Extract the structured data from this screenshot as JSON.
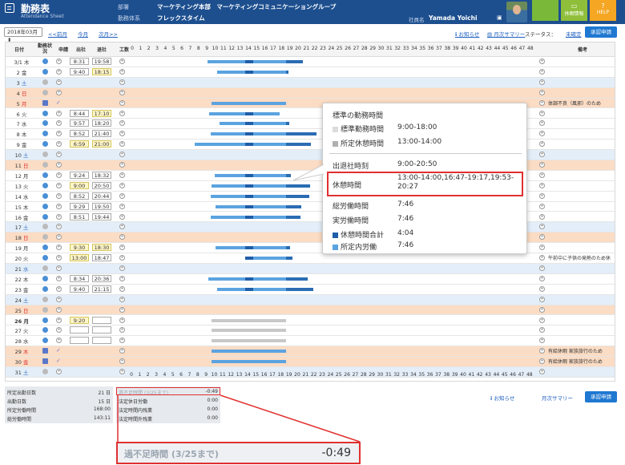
{
  "header": {
    "title": "勤務表",
    "subtitle": "Attendance Sheet",
    "dept_label": "部署",
    "dept": "マーケティング本部　マーケティングコミュニケーショングループ",
    "system_label": "勤務体系",
    "system": "フレックスタイム",
    "user_label": "社員名",
    "user_name": "Yamada Yoichi",
    "btn2": "休暇情報",
    "btn3": "HELP"
  },
  "toolbar": {
    "month": "2018年03月",
    "prev": "<<前月",
    "today": "今月",
    "next": "次月>>",
    "notice": "お知らせ",
    "monthly": "月次サマリー",
    "status_label": "ステータス：",
    "status": "未確定",
    "approve": "承認申請"
  },
  "grid": {
    "headers": [
      "日付",
      "勤務状況",
      "申請",
      "出社",
      "退社",
      "工数"
    ],
    "note_header": "備考",
    "hours": [
      "0",
      "1",
      "2",
      "3",
      "4",
      "5",
      "6",
      "7",
      "8",
      "9",
      "10",
      "11",
      "12",
      "13",
      "14",
      "15",
      "16",
      "17",
      "18",
      "19",
      "20",
      "21",
      "22",
      "23",
      "24",
      "25",
      "26",
      "27",
      "28",
      "29",
      "30",
      "31",
      "32",
      "33",
      "34",
      "35",
      "36",
      "37",
      "38",
      "39",
      "40",
      "41",
      "42",
      "43",
      "44",
      "45",
      "46",
      "47",
      "48"
    ],
    "rows": [
      {
        "d": "3/1",
        "w": "木",
        "in": "8:31",
        "out": "19:58",
        "t": "n"
      },
      {
        "d": "2",
        "w": "金",
        "in": "9:40",
        "out": "18:15",
        "t": "n",
        "y2": 1
      },
      {
        "d": "3",
        "w": "土",
        "t": "s"
      },
      {
        "d": "4",
        "w": "日",
        "t": "h"
      },
      {
        "d": "5",
        "w": "月",
        "t": "h",
        "note": "体調不良（風邪）のため"
      },
      {
        "d": "6",
        "w": "火",
        "in": "8:44",
        "out": "17:10",
        "t": "n",
        "y2": 1
      },
      {
        "d": "7",
        "w": "水",
        "in": "9:57",
        "out": "18:20",
        "t": "n"
      },
      {
        "d": "8",
        "w": "木",
        "in": "8:52",
        "out": "21:40",
        "t": "n"
      },
      {
        "d": "9",
        "w": "金",
        "in": "6:59",
        "out": "21:00",
        "t": "n",
        "y1": 1,
        "y2": 1
      },
      {
        "d": "10",
        "w": "土",
        "t": "s"
      },
      {
        "d": "11",
        "w": "日",
        "t": "h"
      },
      {
        "d": "12",
        "w": "月",
        "in": "9:24",
        "out": "18:32",
        "t": "n"
      },
      {
        "d": "13",
        "w": "火",
        "in": "9:00",
        "out": "20:50",
        "t": "n",
        "y1": 1
      },
      {
        "d": "14",
        "w": "水",
        "in": "8:52",
        "out": "20:44",
        "t": "n"
      },
      {
        "d": "15",
        "w": "木",
        "in": "9:29",
        "out": "19:50",
        "t": "n"
      },
      {
        "d": "16",
        "w": "金",
        "in": "8:51",
        "out": "19:44",
        "t": "n"
      },
      {
        "d": "17",
        "w": "土",
        "t": "s"
      },
      {
        "d": "18",
        "w": "日",
        "t": "h"
      },
      {
        "d": "19",
        "w": "月",
        "in": "9:30",
        "out": "18:30",
        "t": "n",
        "y1": 1,
        "y2": 1
      },
      {
        "d": "20",
        "w": "火",
        "in": "13:00",
        "out": "18:47",
        "t": "n",
        "y1": 1,
        "note": "午前中に子供の発熱のため休"
      },
      {
        "d": "21",
        "w": "水",
        "t": "s"
      },
      {
        "d": "22",
        "w": "木",
        "in": "8:34",
        "out": "20:36",
        "t": "n"
      },
      {
        "d": "23",
        "w": "金",
        "in": "9:40",
        "out": "21:15",
        "t": "n"
      },
      {
        "d": "24",
        "w": "土",
        "t": "s"
      },
      {
        "d": "25",
        "w": "日",
        "t": "h"
      },
      {
        "d": "26",
        "w": "月",
        "in": "9:20",
        "out": "",
        "t": "n",
        "y1": 1,
        "bold": 1
      },
      {
        "d": "27",
        "w": "火",
        "in": "",
        "out": "",
        "t": "n"
      },
      {
        "d": "28",
        "w": "水",
        "in": "",
        "out": "",
        "t": "n"
      },
      {
        "d": "29",
        "w": "木",
        "t": "h",
        "note": "有給休暇 家族旅行のため"
      },
      {
        "d": "30",
        "w": "金",
        "t": "h",
        "note": "有給休暇 家族旅行のため"
      },
      {
        "d": "31",
        "w": "土",
        "t": "s"
      }
    ]
  },
  "tooltip": {
    "std_title": "標準の勤務時間",
    "std_hours_label": "標準勤務時間",
    "std_hours": "9:00-18:00",
    "std_break_label": "所定休憩時間",
    "std_break": "13:00-14:00",
    "inout_label": "出退社時刻",
    "inout": "9:00-20:50",
    "break_label": "休憩時間",
    "break": "13:00-14:00,16:47-19:17,19:53-20:27",
    "total_label": "総労働時間",
    "total": "7:46",
    "actual_label": "実労働時間",
    "actual": "7:46",
    "break_total_label": "休憩時間合計",
    "break_total": "4:04",
    "inwork_label": "所定内労働",
    "inwork": "7:46"
  },
  "stats": {
    "days_label": "所定出勤日数",
    "days": "21 日",
    "worked_label": "出勤日数",
    "worked": "15 日",
    "std_hours_label": "所定労働時間",
    "std_hours": "168:00",
    "total_label": "総労働時間",
    "total": "143:11"
  },
  "stats2": {
    "short_label": "過不足時間 (3/25まで)",
    "short": "-0:49",
    "r2_label": "法定休日労働",
    "r2": "0:00",
    "r3_label": "法定時間内残業",
    "r3": "0:00",
    "r4_label": "法定時間外残業",
    "r4": "0:00"
  },
  "big": {
    "label": "過不足時間 (3/25まで)",
    "value": "-0:49"
  },
  "bottom": {
    "notice": "お知らせ",
    "monthly": "月次サマリー",
    "approve": "承認申請"
  },
  "colors": {
    "header": "#1d4f8f",
    "bar_dark": "#1f5ea8",
    "bar_light": "#5ba3e0",
    "bar_gray": "#c8c8c8",
    "highlight": "#e03030"
  }
}
